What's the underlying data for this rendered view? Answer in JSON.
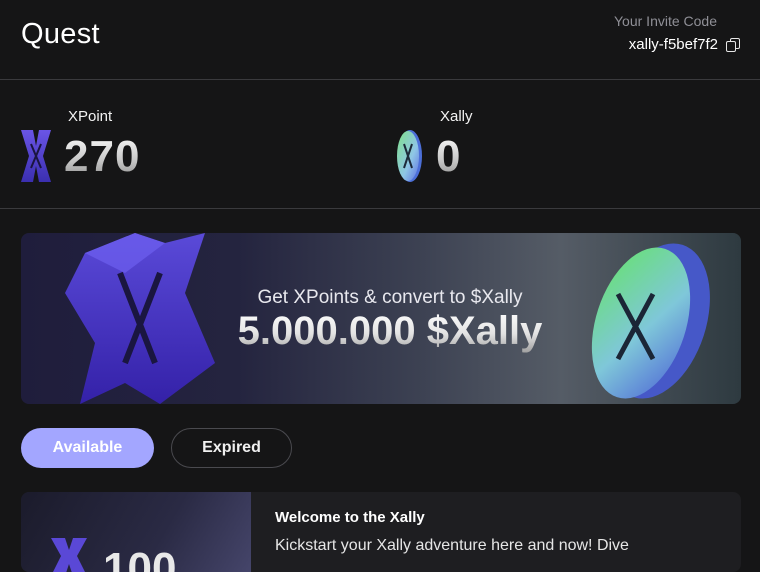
{
  "header": {
    "title": "Quest",
    "invite_label": "Your Invite Code",
    "invite_code": "xally-f5bef7f2"
  },
  "balances": {
    "xpoint": {
      "label": "XPoint",
      "value": "270",
      "icon": "xpoint-logo-icon"
    },
    "xally": {
      "label": "Xally",
      "value": "0",
      "icon": "xally-coin-icon"
    }
  },
  "banner": {
    "subtitle": "Get XPoints & convert to $Xally",
    "headline": "5.000.000 $Xally"
  },
  "tabs": [
    {
      "label": "Available",
      "active": true
    },
    {
      "label": "Expired",
      "active": false
    }
  ],
  "quests": [
    {
      "title": "Welcome to the Xally",
      "description": "Kickstart your Xally adventure here and now! Dive",
      "thumb_value": "100"
    }
  ],
  "colors": {
    "background": "#151516",
    "accent": "#a3a6ff",
    "divider": "#3a3a3d",
    "muted_text": "#8f8f96"
  }
}
